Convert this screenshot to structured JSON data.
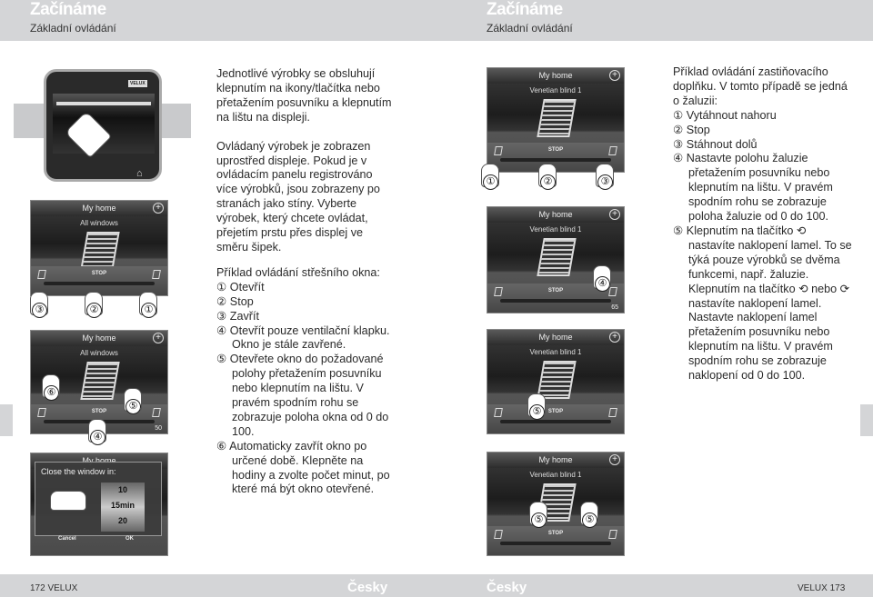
{
  "header": {
    "left_title": "Začínáme",
    "left_subtitle": "Základní ovládání",
    "right_title": "Začínáme",
    "right_subtitle": "Základní ovládání"
  },
  "footer": {
    "left_page": "172  VELUX",
    "left_lang": "Česky",
    "right_lang": "Česky",
    "right_page": "VELUX  173"
  },
  "device": {
    "logo": "VELUX"
  },
  "left_text": {
    "p1": "Jednotlivé výrobky se obsluhují klepnutím na ikony/tlačítka nebo přetažením posuvníku a klepnutím na lištu na displeji.",
    "p2": "Ovládaný výrobek je zobrazen uprostřed displeje. Pokud je v ovládacím panelu registrováno více výrobků, jsou zobrazeny po stranách jako stíny. Vyberte výrobek, který chcete ovládat, přejetím prstu přes displej ve směru šipek.",
    "intro": "Příklad ovládání střešního okna:",
    "items": [
      "① Otevřít",
      "② Stop",
      "③ Zavřít",
      "④ Otevřít pouze ventilační klapku. Okno je stále zavřené.",
      "⑤ Otevřete okno do požadované polohy přetažením posuvníku nebo klepnutím na lištu. V pravém spodním rohu se zobrazuje poloha okna od 0 do 100.",
      "⑥ Automaticky zavřít okno po určené době. Klepněte na hodiny a zvolte počet minut, po které má být okno otevřené."
    ]
  },
  "right_text": {
    "intro": "Příklad ovládání zastiňovacího doplňku. V tomto případě se jedná o žaluzii:",
    "items": [
      "① Vytáhnout nahoru",
      "② Stop",
      "③ Stáhnout dolů",
      "④ Nastavte polohu žaluzie přetažením posuvníku nebo klepnutím na lištu. V pravém spodním rohu se zobrazuje poloha žaluzie od 0 do 100.",
      "⑤ Klepnutím na tlačítko ⟲ nastavíte naklopení lamel. To se týká pouze výrobků se dvěma funkcemi, např. žaluzie. Klepnutím na tlačítko ⟲ nebo ⟳ nastavíte naklopení lamel. Nastavte naklopení lamel přetažením posuvníku nebo klepnutím na lištu. V pravém spodním rohu se zobrazuje naklopení od 0 do 100."
    ]
  },
  "screens": [
    {
      "header": "My home",
      "title": "All windows",
      "stop": "STOP",
      "value": "",
      "callouts": [
        "③",
        "②",
        "①"
      ]
    },
    {
      "header": "My home",
      "title": "All windows",
      "stop": "STOP",
      "value": "50",
      "callouts": [
        "⑥",
        "⑤",
        "④"
      ]
    },
    {
      "header": "My home",
      "title": "Venetian blind 1",
      "stop": "STOP",
      "value": "",
      "callouts": [
        "①",
        "②",
        "③"
      ]
    },
    {
      "header": "My home",
      "title": "Venetian blind 1",
      "stop": "STOP",
      "value": "65",
      "callouts": [
        "④"
      ]
    },
    {
      "header": "My home",
      "title": "Venetian blind 1",
      "stop": "STOP",
      "value": "",
      "callouts": [
        "⑤"
      ]
    },
    {
      "header": "My home",
      "title": "Venetian blind 1",
      "stop": "STOP",
      "value": "",
      "callouts": [
        "⑤",
        "⑤"
      ]
    }
  ],
  "popup": {
    "header": "My home",
    "title": "Close the window in:",
    "options": [
      "10",
      "15min",
      "20"
    ],
    "cancel": "Cancel",
    "ok": "OK"
  }
}
